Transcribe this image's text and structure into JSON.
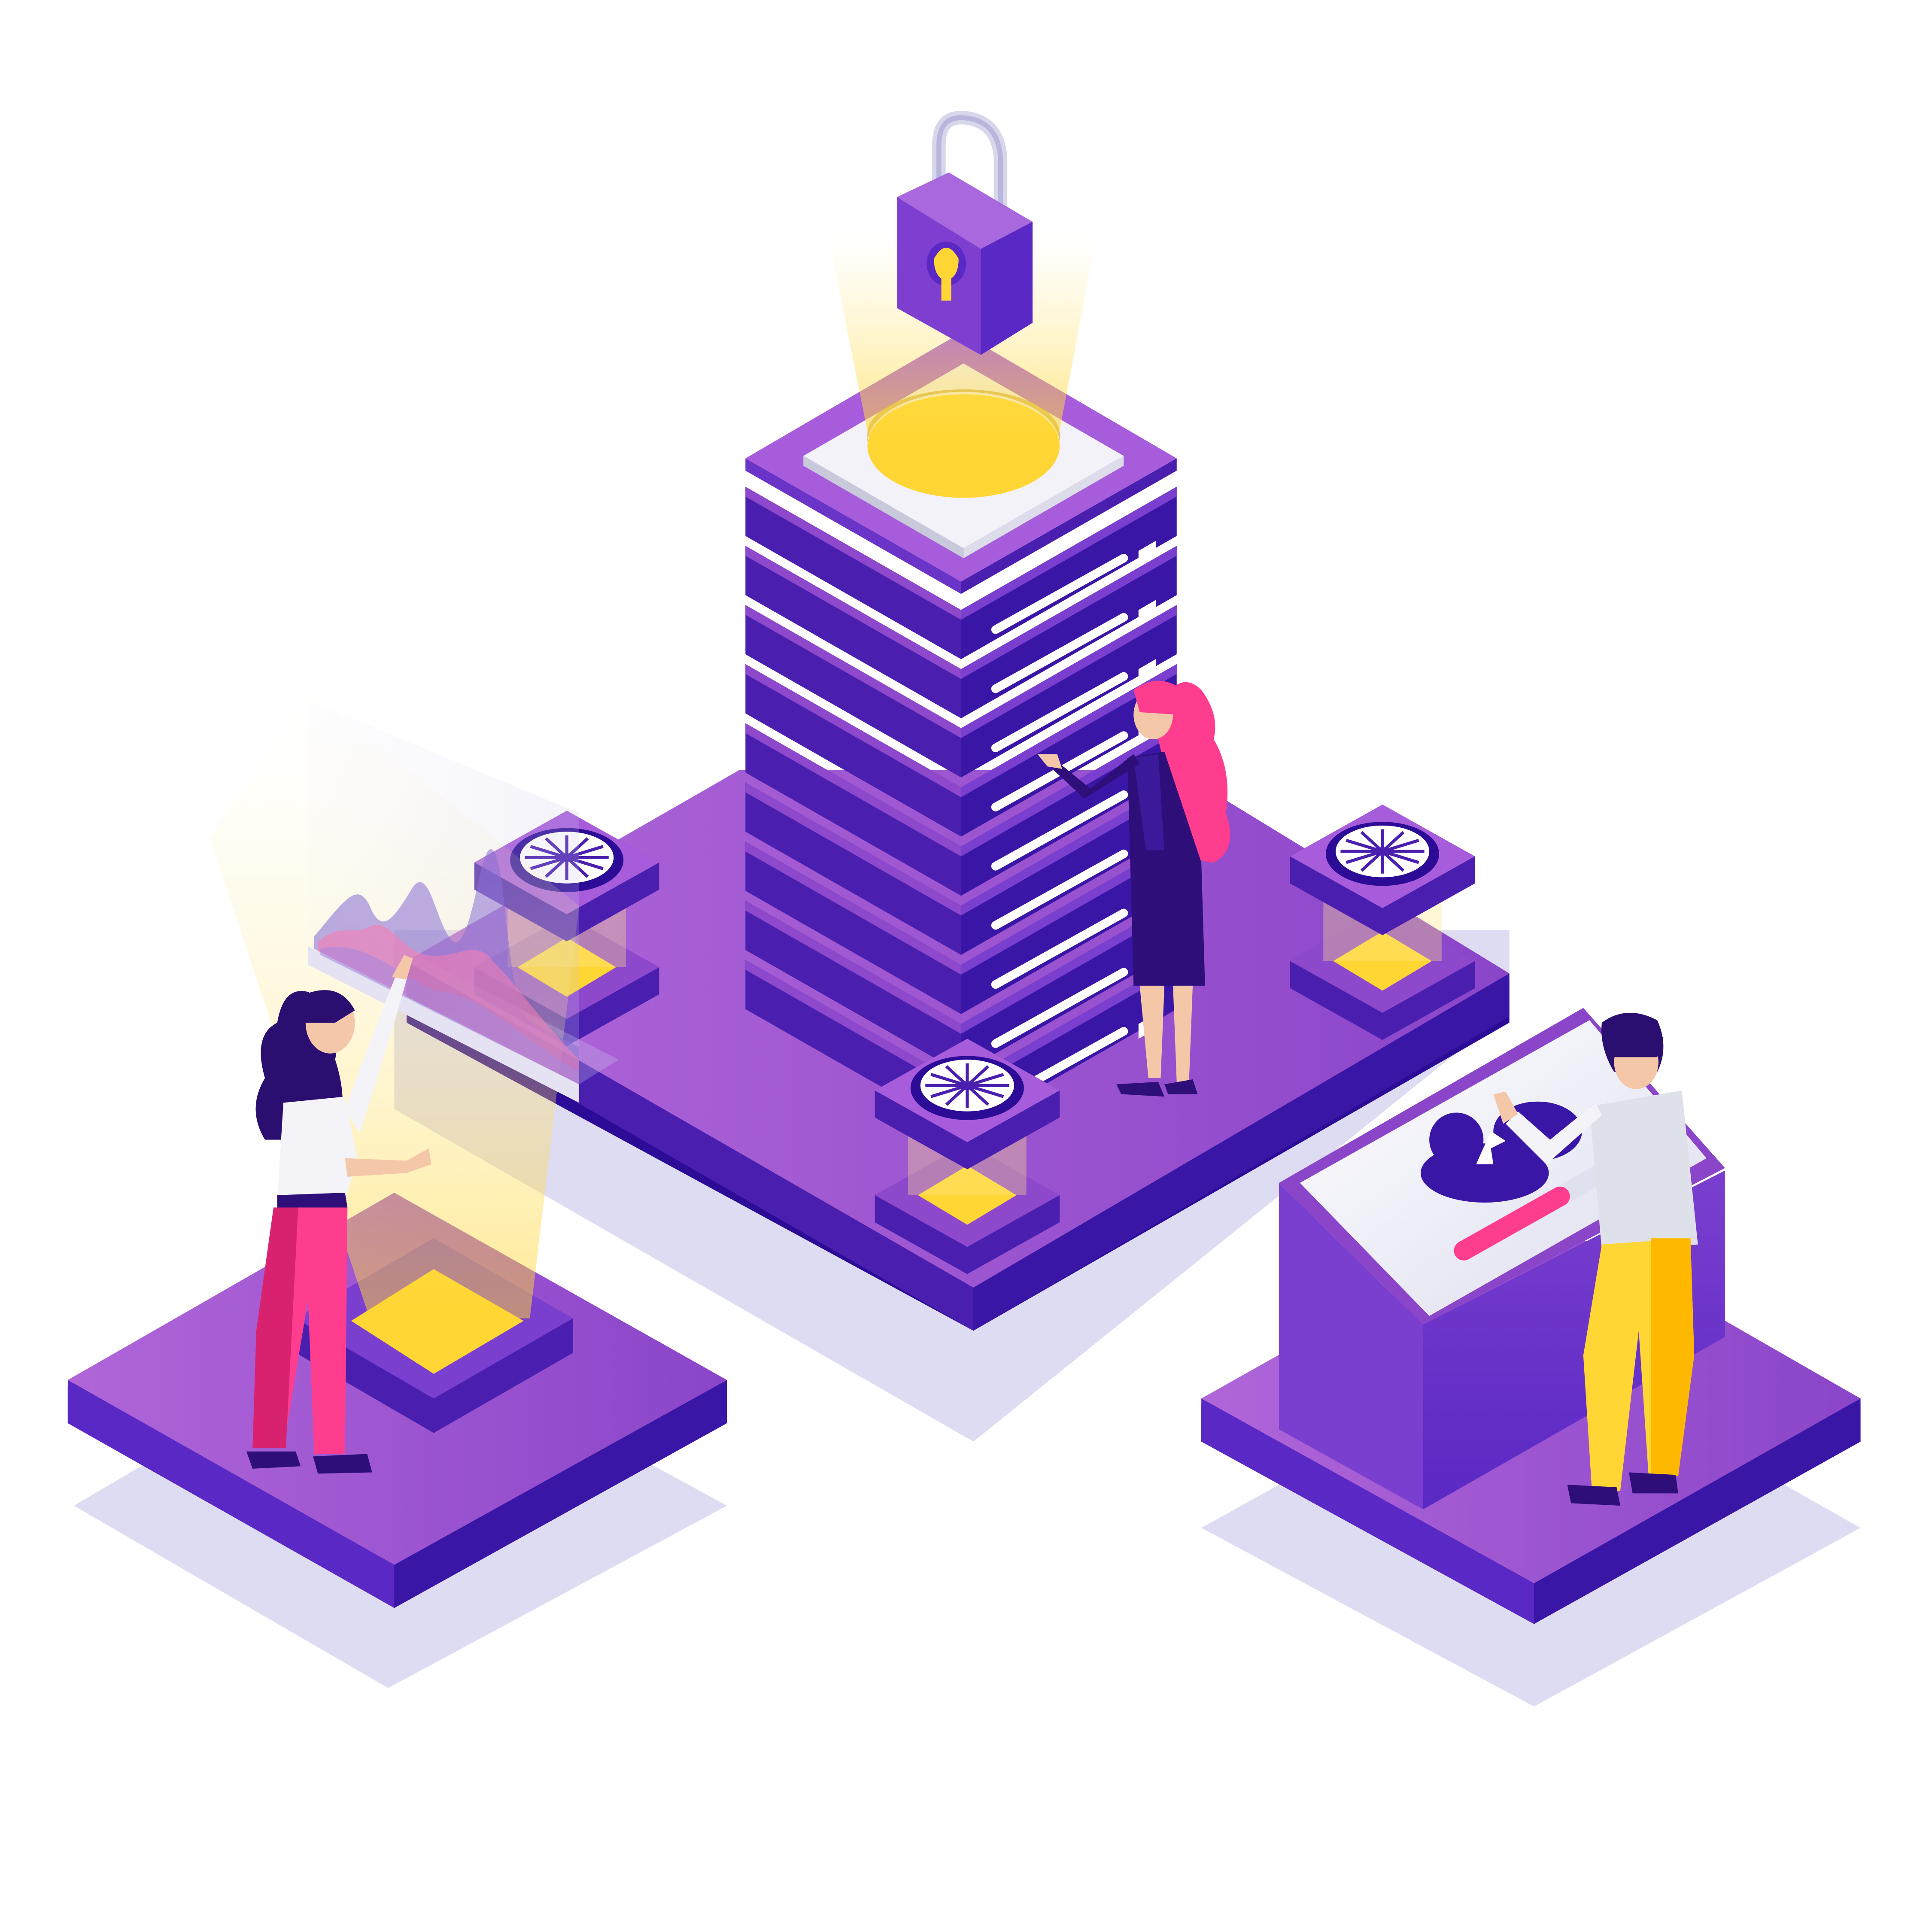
{
  "illustration": {
    "subject": "isometric-data-server-security",
    "palette": {
      "purple_light": "#b066d9",
      "purple_mid": "#8e48cc",
      "purple_dark": "#4a1fb0",
      "purple_deep": "#2c0c96",
      "violet_side": "#5a28c4",
      "shadow": "#dedcf2",
      "yellow": "#ffd633",
      "yellow_glow": "#ffe98a",
      "white_panel": "#f2f2f8",
      "pink": "#ff3d8f",
      "pink_dark": "#d9226f",
      "navy": "#2e0f7a",
      "skin": "#f4c7a8",
      "shirt_white": "#f4f4f8",
      "shirt_grey": "#dfe1ea",
      "pants_yellow": "#ffd633",
      "pants_orange": "#ffb800",
      "hair_dark": "#2a0f70"
    },
    "icons": [
      "padlock-icon",
      "cooling-fan-icon",
      "cloud-upload-icon",
      "wave-chart-icon"
    ],
    "upload_progress": 0.55
  }
}
